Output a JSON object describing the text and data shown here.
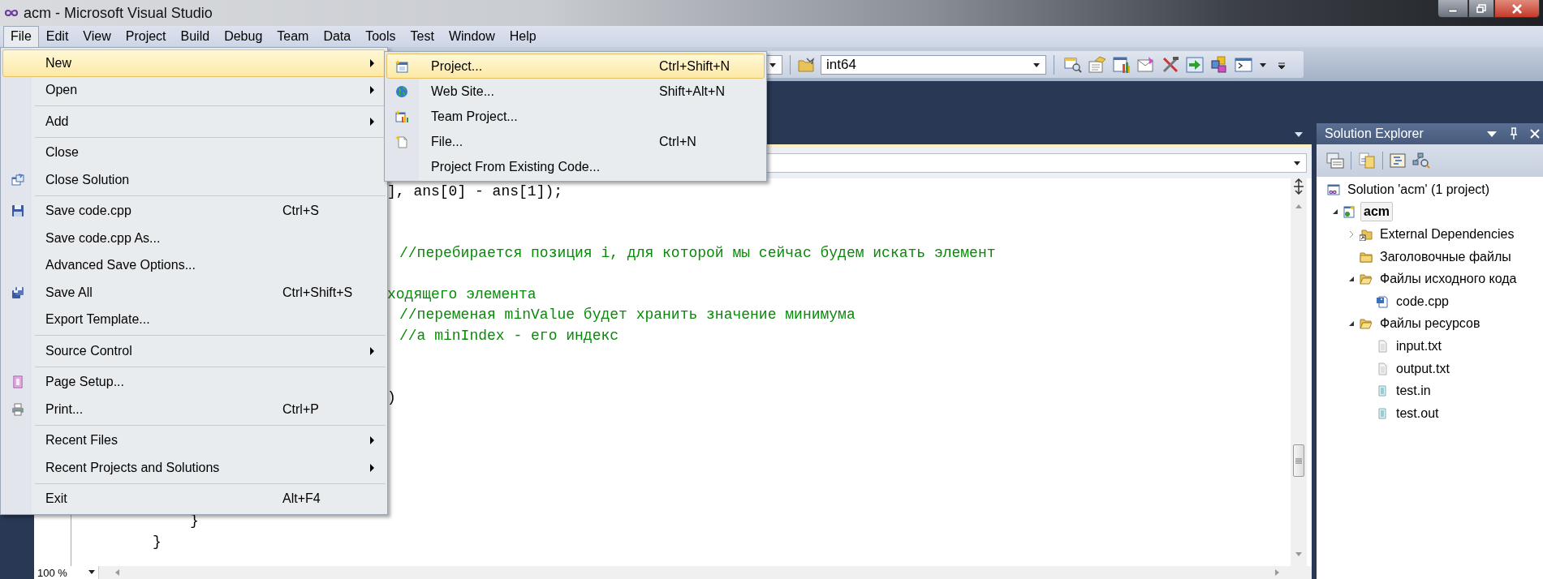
{
  "window": {
    "title": "acm - Microsoft Visual Studio"
  },
  "menu_bar": [
    {
      "label": "File",
      "selected": true
    },
    {
      "label": "Edit",
      "selected": false
    },
    {
      "label": "View",
      "selected": false
    },
    {
      "label": "Project",
      "selected": false
    },
    {
      "label": "Build",
      "selected": false
    },
    {
      "label": "Debug",
      "selected": false
    },
    {
      "label": "Team",
      "selected": false
    },
    {
      "label": "Data",
      "selected": false
    },
    {
      "label": "Tools",
      "selected": false
    },
    {
      "label": "Test",
      "selected": false
    },
    {
      "label": "Window",
      "selected": false
    },
    {
      "label": "Help",
      "selected": false
    }
  ],
  "toolbar": {
    "configuration_combo": {
      "value": "int64"
    }
  },
  "file_menu": {
    "groups": [
      [
        {
          "label": "New",
          "has_submenu": true,
          "selected": true
        },
        {
          "label": "Open",
          "has_submenu": true,
          "selected": false
        }
      ],
      [
        {
          "label": "Add",
          "has_submenu": true,
          "selected": false
        }
      ],
      [
        {
          "label": "Close",
          "selected": false
        },
        {
          "label": "Close Solution",
          "selected": false
        }
      ],
      [
        {
          "label": "Save code.cpp",
          "shortcut": "Ctrl+S",
          "selected": false
        },
        {
          "label": "Save code.cpp As...",
          "selected": false
        },
        {
          "label": "Advanced Save Options...",
          "selected": false
        },
        {
          "label": "Save All",
          "shortcut": "Ctrl+Shift+S",
          "selected": false
        },
        {
          "label": "Export Template...",
          "selected": false
        }
      ],
      [
        {
          "label": "Source Control",
          "has_submenu": true,
          "selected": false
        }
      ],
      [
        {
          "label": "Page Setup...",
          "selected": false
        },
        {
          "label": "Print...",
          "shortcut": "Ctrl+P",
          "selected": false
        }
      ],
      [
        {
          "label": "Recent Files",
          "has_submenu": true,
          "selected": false
        },
        {
          "label": "Recent Projects and Solutions",
          "has_submenu": true,
          "selected": false
        }
      ],
      [
        {
          "label": "Exit",
          "shortcut": "Alt+F4",
          "selected": false
        }
      ]
    ]
  },
  "new_submenu": {
    "items": [
      {
        "label": "Project...",
        "shortcut": "Ctrl+Shift+N",
        "selected": true
      },
      {
        "label": "Web Site...",
        "shortcut": "Shift+Alt+N",
        "selected": false
      },
      {
        "label": "Team Project...",
        "selected": false
      },
      {
        "label": "File...",
        "shortcut": "Ctrl+N",
        "selected": false
      },
      {
        "label": "Project From Existing Code...",
        "selected": false
      }
    ]
  },
  "editor": {
    "code_lines": [
      {
        "text": "], ans[0] - ans[1]);",
        "kind": "code"
      },
      {
        "text": "//перебирается позиция i, для которой мы сейчас будем искать элемент",
        "kind": "comment"
      },
      {
        "text": "ходящего элемента",
        "kind": "comment"
      },
      {
        "text": "//переменая minValue будет хранить значение минимума",
        "kind": "comment"
      },
      {
        "text": "//a minIndex - его индекс",
        "kind": "comment"
      },
      {
        "text": ")",
        "kind": "code"
      },
      {
        "text": "}",
        "kind": "code"
      },
      {
        "text": "}",
        "kind": "code"
      }
    ],
    "zoom": "100 %"
  },
  "solution_explorer": {
    "title": "Solution Explorer",
    "tree": [
      {
        "label": "Solution 'acm' (1 project)",
        "kind": "solution",
        "selected": false,
        "children": [
          {
            "label": "acm",
            "kind": "project",
            "selected": true,
            "expanded": true,
            "children": [
              {
                "label": "External Dependencies",
                "kind": "dependencies",
                "selected": false,
                "expanded": false
              },
              {
                "label": "Заголовочные файлы",
                "kind": "folder",
                "selected": false
              },
              {
                "label": "Файлы исходного кода",
                "kind": "folder",
                "selected": false,
                "expanded": true,
                "children": [
                  {
                    "label": "code.cpp",
                    "kind": "cpp",
                    "selected": false
                  }
                ]
              },
              {
                "label": "Файлы ресурсов",
                "kind": "folder",
                "selected": false,
                "expanded": true,
                "children": [
                  {
                    "label": "input.txt",
                    "kind": "text",
                    "selected": false
                  },
                  {
                    "label": "output.txt",
                    "kind": "text",
                    "selected": false
                  },
                  {
                    "label": "test.in",
                    "kind": "data",
                    "selected": false
                  },
                  {
                    "label": "test.out",
                    "kind": "data",
                    "selected": false
                  }
                ]
              }
            ]
          }
        ]
      }
    ]
  }
}
